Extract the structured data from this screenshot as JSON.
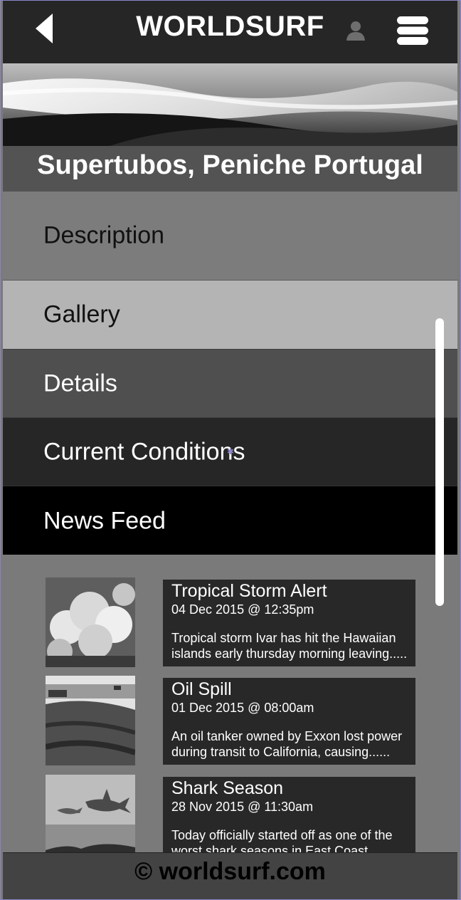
{
  "header": {
    "title": "WORLDSURF",
    "back_icon": "back-arrow-icon",
    "user_icon": "user-icon",
    "menu_icon": "hamburger-menu-icon"
  },
  "location": {
    "name": "Supertubos, Peniche Portugal"
  },
  "tabs": [
    {
      "label": "Description"
    },
    {
      "label": "Gallery",
      "selected": true
    },
    {
      "label": "Details"
    },
    {
      "label": "Current Conditions"
    },
    {
      "label": "News Feed"
    }
  ],
  "news": [
    {
      "title": "Tropical Storm Alert",
      "date": "04 Dec 2015 @ 12:35pm",
      "text": "Tropical storm Ivar has hit the Hawaiian islands early thursday morning leaving....."
    },
    {
      "title": "Oil Spill",
      "date": "01 Dec 2015 @ 08:00am",
      "text": "An oil tanker owned by Exxon lost power during transit to California, causing......"
    },
    {
      "title": "Shark Season",
      "date": "28 Nov 2015 @ 11:30am",
      "text": "Today officially started off as one of the worst shark seasons in East Coast history....."
    }
  ],
  "footer": {
    "text": "© worldsurf.com"
  }
}
